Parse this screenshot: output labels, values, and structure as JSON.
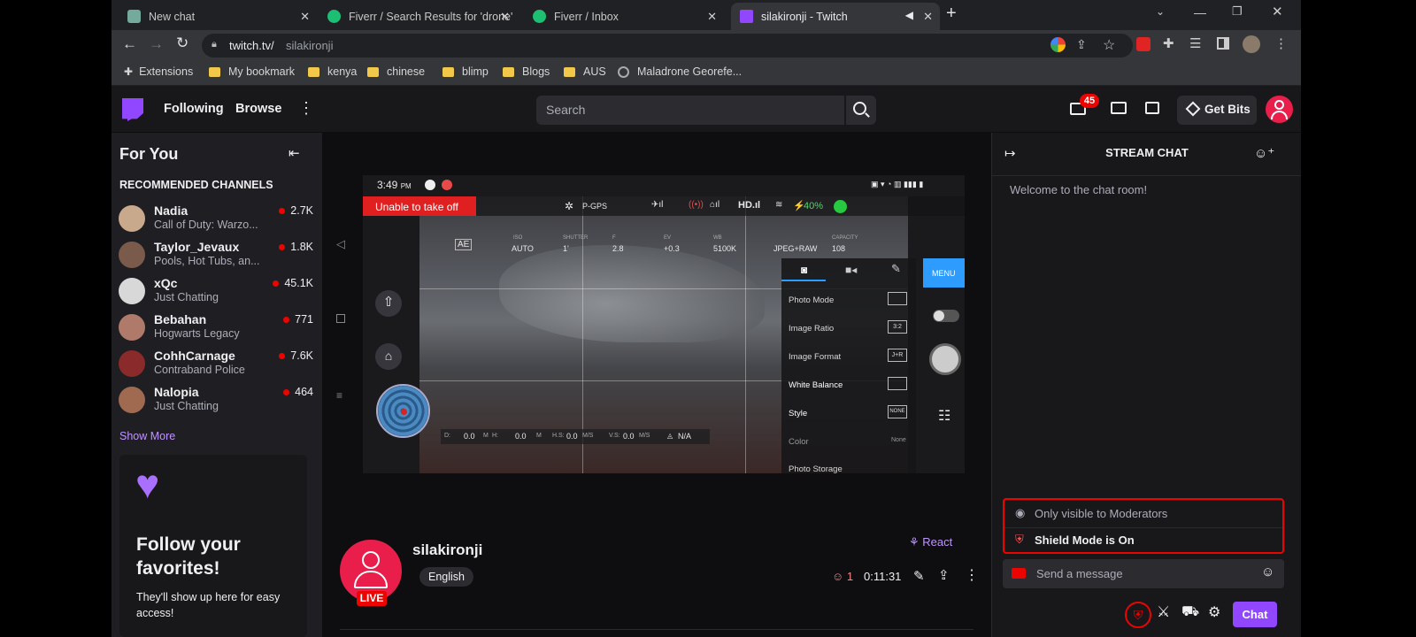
{
  "browser": {
    "tabs": [
      {
        "label": "New chat",
        "active": false
      },
      {
        "label": "Fiverr / Search Results for 'drone'",
        "active": false
      },
      {
        "label": "Fiverr / Inbox",
        "active": false
      },
      {
        "label": "silakironji - Twitch",
        "active": true
      }
    ],
    "new_tab": "+",
    "url_domain": "twitch.tv/",
    "url_path": "silakironji",
    "bookmarks": [
      "Extensions",
      "My bookmark",
      "kenya",
      "chinese",
      "blimp",
      "Blogs",
      "AUS",
      "Maladrone Georefe..."
    ]
  },
  "nav": {
    "following": "Following",
    "browse": "Browse",
    "search_placeholder": "Search",
    "notif_count": "45",
    "get_bits": "Get Bits"
  },
  "sidebar": {
    "heading": "For You",
    "section": "RECOMMENDED CHANNELS",
    "channels": [
      {
        "name": "Nadia",
        "game": "Call of Duty: Warzo...",
        "viewers": "2.7K",
        "color": "#c9a98c"
      },
      {
        "name": "Taylor_Jevaux",
        "game": "Pools, Hot Tubs, an...",
        "viewers": "1.8K",
        "color": "#7a5a4a"
      },
      {
        "name": "xQc",
        "game": "Just Chatting",
        "viewers": "45.1K",
        "color": "#d8d8d8"
      },
      {
        "name": "Bebahan",
        "game": "Hogwarts Legacy",
        "viewers": "771",
        "color": "#b07a6a"
      },
      {
        "name": "CohhCarnage",
        "game": "Contraband Police",
        "viewers": "7.6K",
        "color": "#8a2a2a"
      },
      {
        "name": "Nalopia",
        "game": "Just Chatting",
        "viewers": "464",
        "color": "#a06a50"
      }
    ],
    "show_more": "Show More",
    "promo_title": "Follow your favorites!",
    "promo_body": "They'll show up here for easy access!"
  },
  "stream": {
    "osd": {
      "time": "3:49",
      "time_suffix": "PM",
      "warning": "Unable to take off",
      "gps": "P-GPS",
      "hd": "HD",
      "battery": "40%",
      "ae": "AE",
      "iso_label": "ISO",
      "iso": "AUTO",
      "shutter_label": "SHUTTER",
      "shutter": "1'",
      "f_label": "F",
      "f": "2.8",
      "ev_label": "EV",
      "ev": "+0.3",
      "wb_label": "WB",
      "wb": "5100K",
      "format": "JPEG+RAW",
      "capacity_label": "CAPACITY",
      "capacity": "108",
      "menu": "MENU",
      "telemetry": {
        "d_label": "D:",
        "d": "0.0",
        "m1": "M",
        "h_label": "H:",
        "h": "0.0",
        "m2": "M",
        "hs_label": "H.S:",
        "hs": "0.0",
        "ms1": "M/S",
        "vs_label": "V.S:",
        "vs": "0.0",
        "ms2": "M/S",
        "na": "N/A"
      },
      "camera_menu": [
        {
          "label": "Photo Mode",
          "value": ""
        },
        {
          "label": "Image Ratio",
          "value": "3:2"
        },
        {
          "label": "Image Format",
          "value": "J+R"
        },
        {
          "label": "White Balance",
          "value": ""
        },
        {
          "label": "Style",
          "value": "NONE"
        },
        {
          "label": "Color",
          "value": "None"
        },
        {
          "label": "Photo Storage",
          "value": ""
        }
      ]
    }
  },
  "channel": {
    "name": "silakironji",
    "live": "LIVE",
    "language": "English",
    "react": "React",
    "viewers": "1",
    "uptime": "0:11:31"
  },
  "chat": {
    "header": "STREAM CHAT",
    "welcome": "Welcome to the chat room!",
    "mod_visibility": "Only visible to Moderators",
    "shield_mode": "Shield Mode is On",
    "input_placeholder": "Send a message",
    "send": "Chat"
  },
  "colors": {
    "twitch_purple": "#9147ff",
    "live_red": "#eb0400",
    "warning_red": "#e02020"
  }
}
